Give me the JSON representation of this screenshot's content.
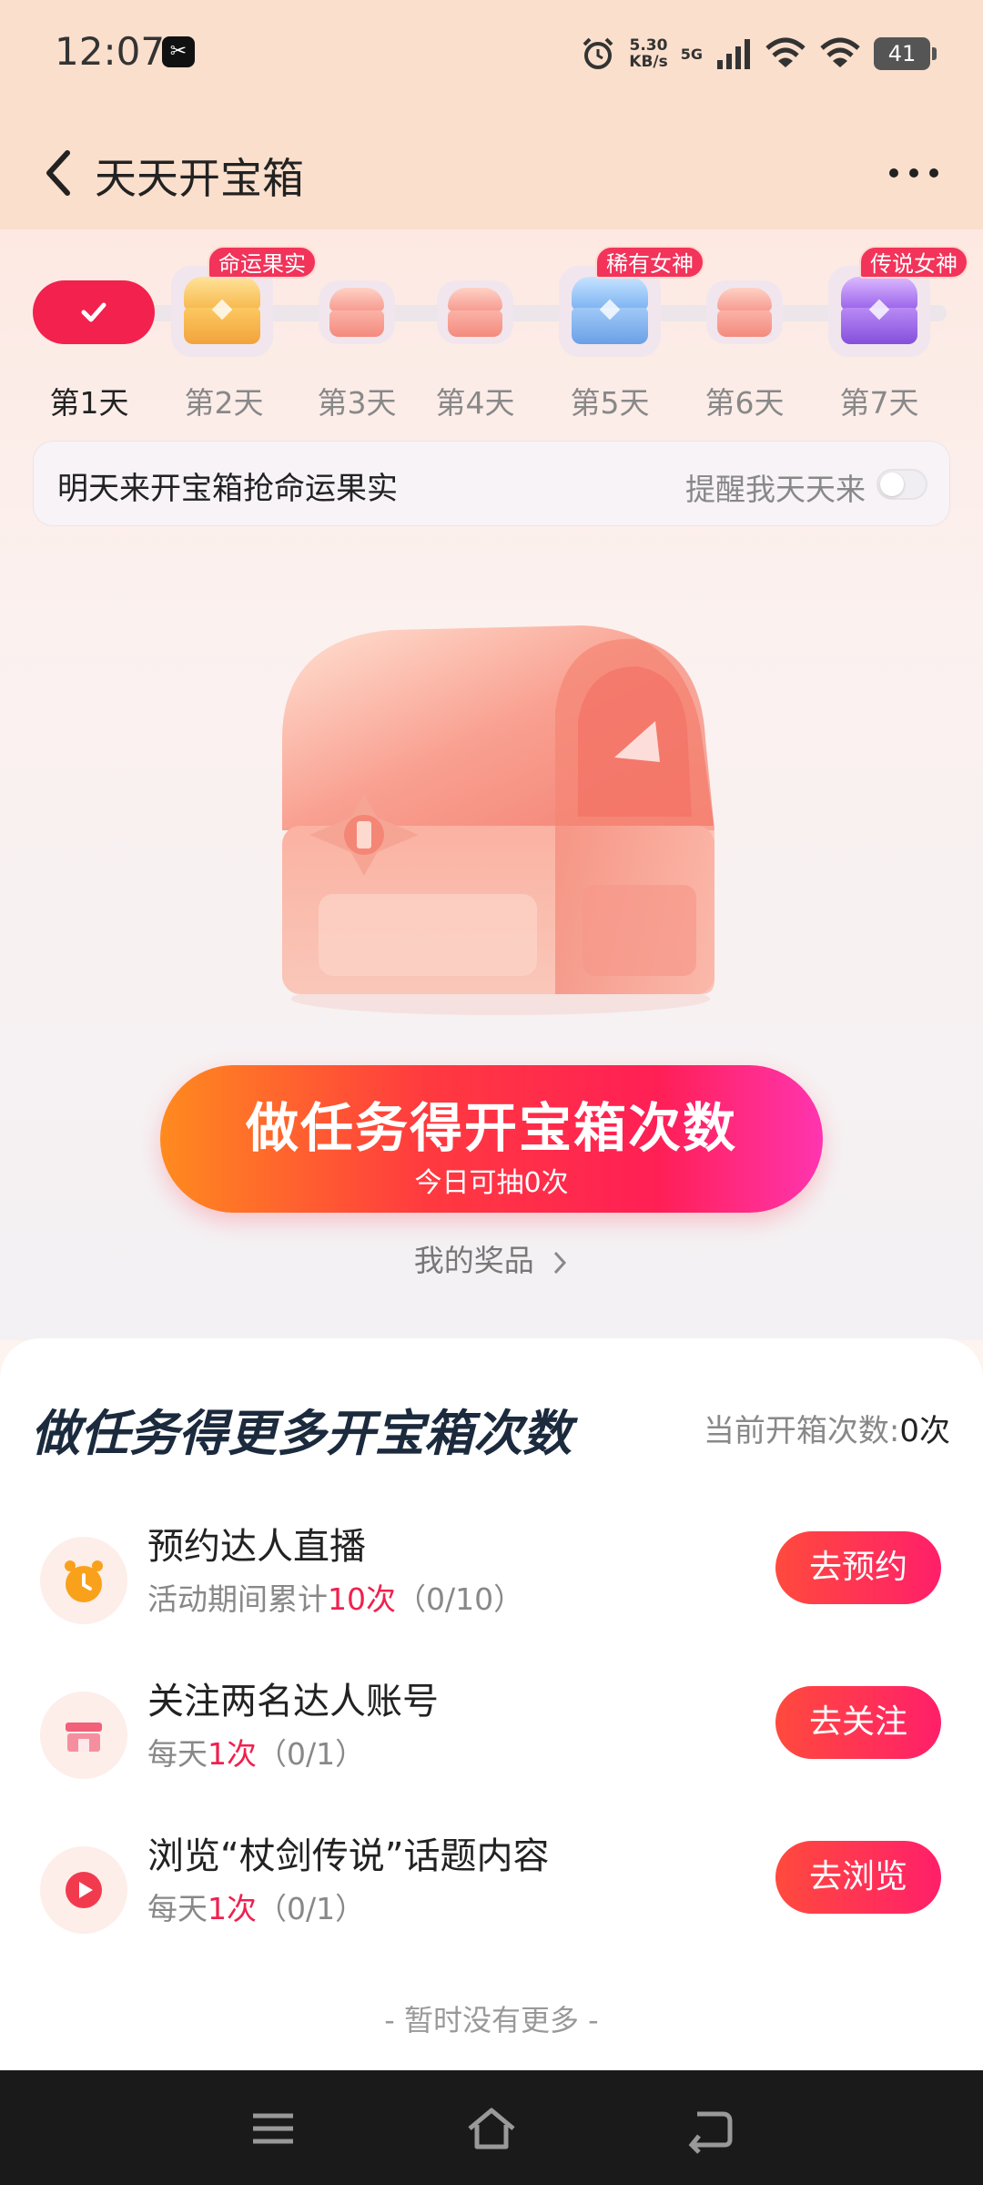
{
  "status_bar": {
    "time": "12:07",
    "app_badge": "✂",
    "speed_value": "5.30",
    "speed_unit": "KB/s",
    "network": "5G",
    "battery": "41"
  },
  "header": {
    "title": "天天开宝箱",
    "back_icon": "chevron-left-icon",
    "more_icon": "more-dots-icon"
  },
  "days": [
    {
      "label": "第1天",
      "state": "done"
    },
    {
      "label": "第2天",
      "tag": "命运果实",
      "chest": "gold"
    },
    {
      "label": "第3天",
      "chest": "pink"
    },
    {
      "label": "第4天",
      "chest": "pink"
    },
    {
      "label": "第5天",
      "tag": "稀有女神",
      "chest": "blue"
    },
    {
      "label": "第6天",
      "chest": "pink"
    },
    {
      "label": "第7天",
      "tag": "传说女神",
      "chest": "purple"
    }
  ],
  "reminder": {
    "text": "明天来开宝箱抢命运果实",
    "toggle_label": "提醒我天天来",
    "enabled": false
  },
  "cta": {
    "title": "做任务得开宝箱次数",
    "subtitle": "今日可抽0次"
  },
  "prizes_link": "我的奖品",
  "tasks_section": {
    "title": "做任务得更多开宝箱次数",
    "count_label": "当前开箱次数:",
    "count_value": "0次",
    "tasks": [
      {
        "title": "预约达人直播",
        "sub_prefix": "活动期间累计",
        "sub_highlight": "10次",
        "sub_suffix": "（0/10）",
        "button": "去预约",
        "icon": "alarm-clock-icon"
      },
      {
        "title": "关注两名达人账号",
        "sub_prefix": "每天",
        "sub_highlight": "1次",
        "sub_suffix": "（0/1）",
        "button": "去关注",
        "icon": "store-icon"
      },
      {
        "title": "浏览“杖剑传说”话题内容",
        "sub_prefix": "每天",
        "sub_highlight": "1次",
        "sub_suffix": "（0/1）",
        "button": "去浏览",
        "icon": "play-icon"
      }
    ],
    "footer": "- 暂时没有更多 -"
  },
  "colors": {
    "accent": "#f2214d",
    "header_bg": "#fadfcc",
    "title_dark": "#1b2a3d"
  }
}
